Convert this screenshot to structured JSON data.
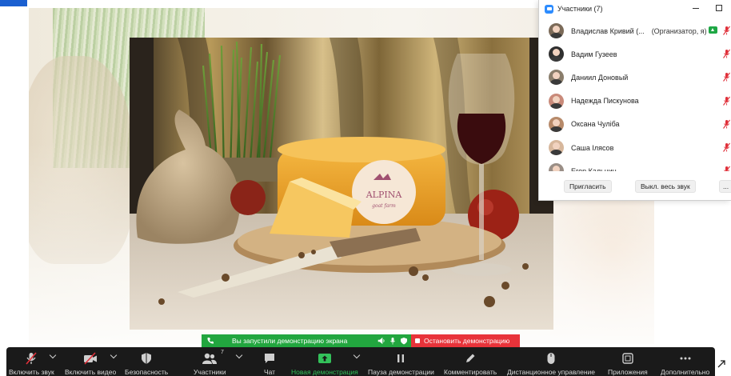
{
  "participants_panel": {
    "title": "Участники (7)",
    "participants": [
      {
        "name": "Владислав Кривий (...",
        "role": "(Организатор, я)",
        "sharing": true,
        "mic_muted": true,
        "avatar_color": "#7b6a58"
      },
      {
        "name": "Вадим Гузеев",
        "role": "",
        "sharing": false,
        "mic_muted": true,
        "avatar_color": "#2f2f2f"
      },
      {
        "name": "Даниил Доновый",
        "role": "",
        "sharing": false,
        "mic_muted": true,
        "avatar_color": "#8a7d6b"
      },
      {
        "name": "Надежда Пискунова",
        "role": "",
        "sharing": false,
        "mic_muted": true,
        "avatar_color": "#c98a7a"
      },
      {
        "name": "Оксана Чуліба",
        "role": "",
        "sharing": false,
        "mic_muted": true,
        "avatar_color": "#b78a6a"
      },
      {
        "name": "Саша Ілясов",
        "role": "",
        "sharing": false,
        "mic_muted": true,
        "avatar_color": "#d7b79c"
      },
      {
        "name": "Егор Кальнин",
        "role": "",
        "sharing": false,
        "mic_muted": true,
        "avatar_color": "#9a8e86"
      }
    ],
    "invite_label": "Пригласить",
    "mute_all_label": "Выкл. весь звук",
    "more_label": "..."
  },
  "share_bar": {
    "status_text": "Вы запустили демонстрацию экрана",
    "stop_label": "Остановить демонстрацию"
  },
  "toolbar": {
    "items": [
      {
        "label": "Включить звук",
        "icon": "mic-muted-icon"
      },
      {
        "label": "Включить видео",
        "icon": "video-off-icon"
      },
      {
        "label": "Безопасность",
        "icon": "shield-icon"
      },
      {
        "label": "Участники",
        "icon": "participants-icon",
        "count": "7"
      },
      {
        "label": "Чат",
        "icon": "chat-icon"
      },
      {
        "label": "Новая демонстрация",
        "icon": "share-screen-icon"
      },
      {
        "label": "Пауза демонстрации",
        "icon": "pause-icon"
      },
      {
        "label": "Комментировать",
        "icon": "pen-icon"
      },
      {
        "label": "Дистанционное управление",
        "icon": "mouse-icon"
      },
      {
        "label": "Приложения",
        "icon": "apps-icon"
      },
      {
        "label": "Дополнительно",
        "icon": "more-icon"
      }
    ]
  },
  "photo": {
    "logo_text": "ALPINA",
    "logo_subtext": "goat farm"
  },
  "colors": {
    "share_green": "#22a63f",
    "stop_red": "#e8333a",
    "toolbar_bg": "#1a1a1a",
    "zoom_blue": "#2d8cff",
    "muted_red": "#e0303a"
  }
}
